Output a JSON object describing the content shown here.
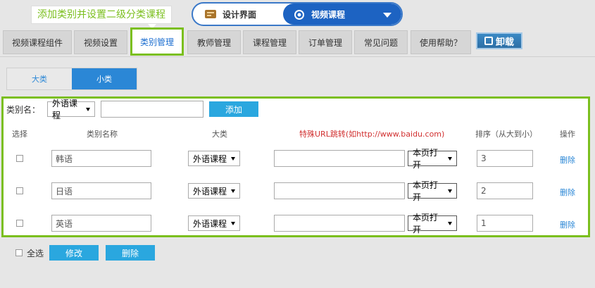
{
  "callout": {
    "text": "添加类别并设置二级分类课程"
  },
  "switcher": {
    "left_label": "设计界面",
    "right_label": "视频课程"
  },
  "tabs": [
    {
      "label": "视频课程组件",
      "active": false
    },
    {
      "label": "视频设置",
      "active": false
    },
    {
      "label": "类别管理",
      "active": true
    },
    {
      "label": "教师管理",
      "active": false
    },
    {
      "label": "课程管理",
      "active": false
    },
    {
      "label": "订单管理",
      "active": false
    },
    {
      "label": "常见问题",
      "active": false
    },
    {
      "label": "使用帮助？",
      "active": false
    }
  ],
  "unload_button": {
    "label": "卸载"
  },
  "subtabs": [
    {
      "label": "大类",
      "active": false
    },
    {
      "label": "小类",
      "active": true
    }
  ],
  "add_form": {
    "label": "类别名：",
    "select_value": "外语课程",
    "input_value": "",
    "add_label": "添加"
  },
  "table": {
    "headers": {
      "select": "选择",
      "name": "类别名称",
      "parent": "大类",
      "url": "特殊URL跳转(如http://www.baidu.com)",
      "order": "排序（从大到小）",
      "action": "操作"
    },
    "rows": [
      {
        "name": "韩语",
        "parent": "外语课程",
        "url": "",
        "open_mode": "本页打开",
        "order": "3",
        "delete_label": "删除"
      },
      {
        "name": "日语",
        "parent": "外语课程",
        "url": "",
        "open_mode": "本页打开",
        "order": "2",
        "delete_label": "删除"
      },
      {
        "name": "英语",
        "parent": "外语课程",
        "url": "",
        "open_mode": "本页打开",
        "order": "1",
        "delete_label": "删除"
      }
    ]
  },
  "bottom": {
    "select_all_label": "全选",
    "edit_label": "修改",
    "delete_label": "删除"
  },
  "colors": {
    "accent_green": "#7bbf1e",
    "primary_blue": "#2aa7df",
    "switcher_blue": "#1d63c2"
  }
}
